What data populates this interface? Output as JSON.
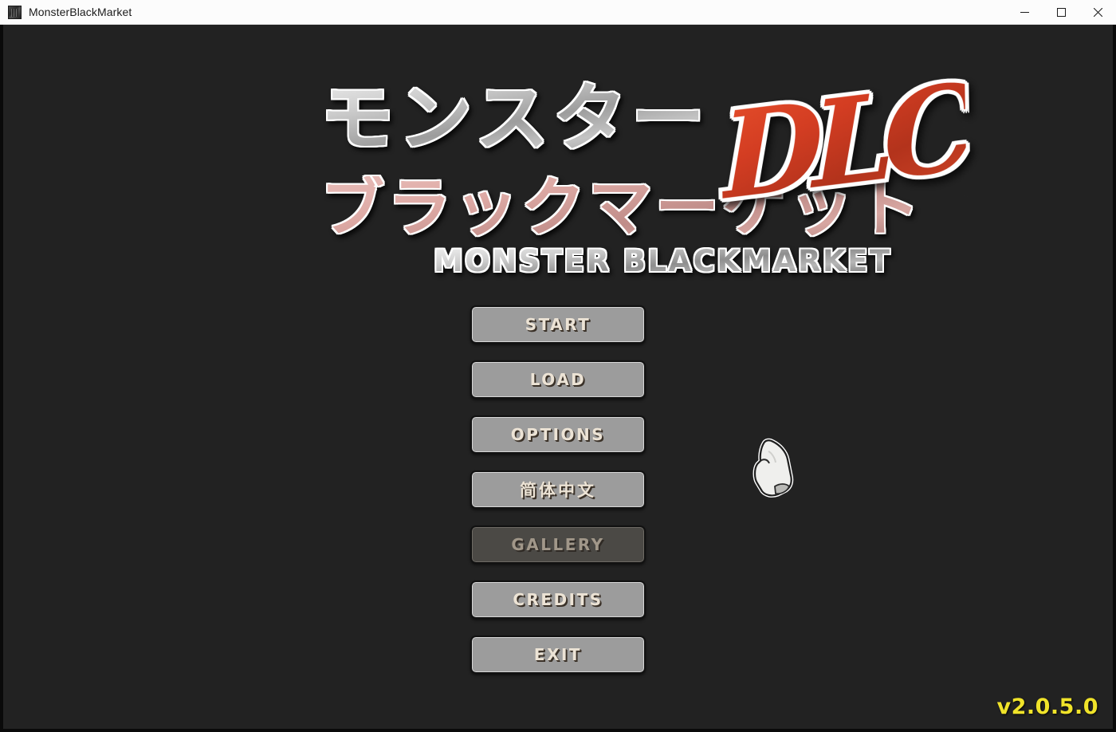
{
  "window": {
    "title": "MonsterBlackMarket",
    "icon": "app-icon",
    "controls": {
      "minimize": "Minimize",
      "maximize": "Maximize",
      "close": "Close"
    }
  },
  "logo": {
    "japanese_line1": "モンスター",
    "japanese_line2": "ブラックマーケット",
    "dlc_badge": "DLC",
    "english_subtitle": "MONSTER BLACKMARKET"
  },
  "menu": {
    "items": [
      {
        "label": "START",
        "name": "start",
        "disabled": false
      },
      {
        "label": "LOAD",
        "name": "load",
        "disabled": false
      },
      {
        "label": "OPTIONS",
        "name": "options",
        "disabled": false
      },
      {
        "label": "简体中文",
        "name": "language",
        "disabled": false
      },
      {
        "label": "GALLERY",
        "name": "gallery",
        "disabled": true
      },
      {
        "label": "CREDITS",
        "name": "credits",
        "disabled": false
      },
      {
        "label": "EXIT",
        "name": "exit",
        "disabled": false
      }
    ]
  },
  "cursor": {
    "icon": "pointing-hand-cursor"
  },
  "footer": {
    "version": "v2.0.5.0"
  },
  "colors": {
    "background": "#222222",
    "titlebar": "#fcfcfc",
    "button_fill": "#9c9c9c",
    "button_disabled_fill": "#4b4945",
    "button_text": "#ece3d5",
    "version_text": "#f0e32a",
    "dlc_red": "#d33d22",
    "logo_pink": "#dda9a4"
  }
}
